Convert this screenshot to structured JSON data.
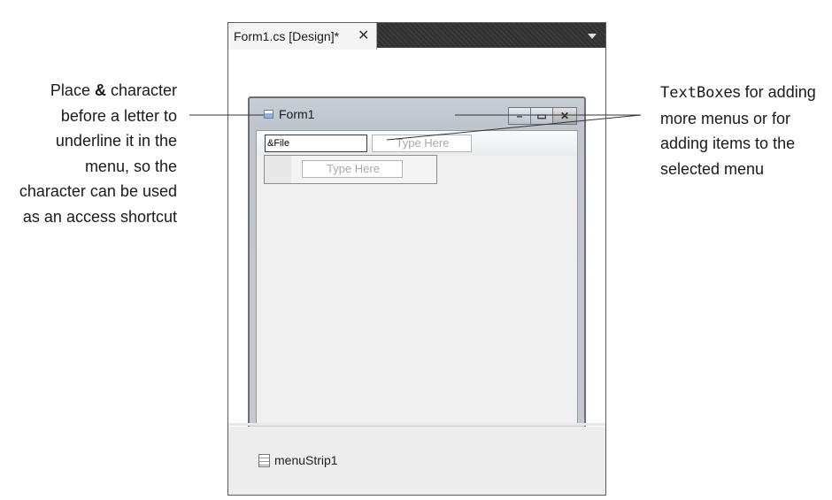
{
  "callouts": {
    "left": {
      "before_amp": "Place ",
      "amp": "&",
      "after_amp": " character before a letter to underline it in the menu, so the character can be used as an access shortcut"
    },
    "right": {
      "mono": "TextBox",
      "rest": "es for adding more menus or for adding items to the selected menu"
    }
  },
  "designer": {
    "tab_label": "Form1.cs [Design]*",
    "tab_close": "✕",
    "tray_item": "menuStrip1"
  },
  "form": {
    "title": "Form1",
    "caption_buttons": {
      "minimize": "–",
      "maximize": "▭",
      "close": "✕"
    },
    "menu": {
      "file_value": "&File",
      "type_here_top": "Type Here",
      "type_here_sub": "Type Here"
    }
  }
}
